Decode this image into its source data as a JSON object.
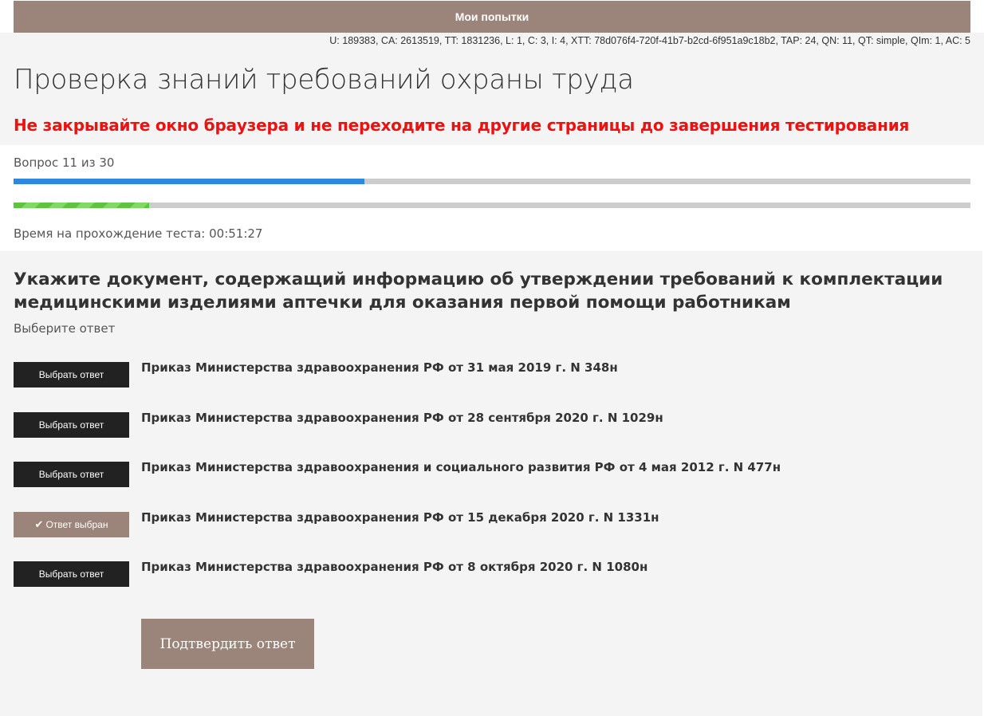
{
  "topbar": {
    "label": "Мои попытки"
  },
  "debug_info": "U: 189383, CA: 2613519, TT: 1831236, L: 1, C: 3, I: 4, XTT: 78d076f4-720f-41b7-b2cd-6f951a9c18b2, TAP: 24, QN: 11, QT: simple, QIm: 1, AC: 5",
  "page_title": "Проверка знаний требований охраны труда",
  "warning": "Не закрывайте окно браузера и не переходите на другие страницы до завершения тестирования",
  "progress": {
    "counter_text": "Вопрос 11 из 30",
    "questions_fraction": 0.3667,
    "second_bar_fraction": 0.142,
    "timer_text": "Время на прохождение теста: 00:51:27"
  },
  "question": {
    "text": "Укажите документ, содержащий информацию об утверждении требований к комплектации медицинскими изделиями аптечки для оказания первой помощи работникам",
    "hint": "Выберите ответ"
  },
  "answers": [
    {
      "button_label": "Выбрать ответ",
      "text": "Приказ Министерства здравоохранения РФ от 31 мая 2019 г. N 348н",
      "selected": false
    },
    {
      "button_label": "Выбрать ответ",
      "text": "Приказ Министерства здравоохранения РФ от 28 сентября 2020 г. N 1029н",
      "selected": false
    },
    {
      "button_label": "Выбрать ответ",
      "text": "Приказ Министерства здравоохранения и социального развития РФ от 4 мая 2012 г. N 477н",
      "selected": false
    },
    {
      "button_label": "Ответ выбран",
      "text": "Приказ Министерства здравоохранения РФ от 15 декабря 2020 г. N 1331н",
      "selected": true
    },
    {
      "button_label": "Выбрать ответ",
      "text": "Приказ Министерства здравоохранения РФ от 8 октября 2020 г. N 1080н",
      "selected": false
    }
  ],
  "confirm_label": "Подтвердить ответ",
  "colors": {
    "accent": "#9b8479",
    "dark_button": "#222222",
    "warning": "#ee1111",
    "progress_blue": "#2f88e0",
    "progress_green": "#5cc43f",
    "track": "#cccccc",
    "panel_bg": "#f4f4f4"
  },
  "icons": {
    "selected_check": "check-icon"
  }
}
